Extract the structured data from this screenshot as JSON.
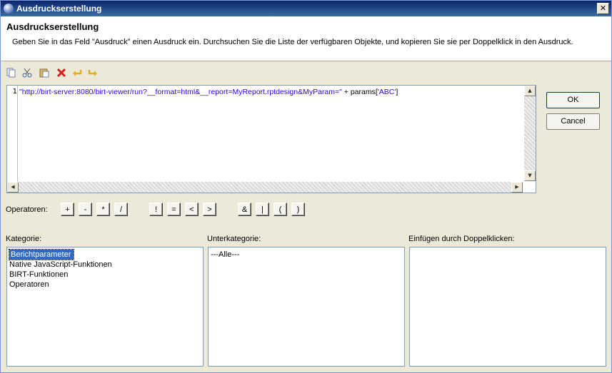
{
  "window": {
    "title": "Ausdruckserstellung"
  },
  "header": {
    "title": "Ausdruckserstellung",
    "description": "Geben Sie in das Feld \"Ausdruck\" einen Ausdruck ein. Durchsuchen Sie die Liste der verfügbaren Objekte, und kopieren Sie sie per Doppelklick in den Ausdruck."
  },
  "toolbar": {
    "icons": [
      "copy-icon",
      "cut-icon",
      "paste-icon",
      "delete-icon",
      "undo-icon",
      "redo-icon"
    ]
  },
  "editor": {
    "line_number": "1",
    "string_part": "\"http://birt-server:8080/birt-viewer/run?__format=html&__report=MyReport.rptdesign&MyParam=\"",
    "plain_part": " + params[",
    "string_part2": "'ABC'",
    "plain_end": "]"
  },
  "buttons": {
    "ok": "OK",
    "cancel": "Cancel"
  },
  "operators": {
    "label": "Operatoren:",
    "items": [
      "+",
      "-",
      "*",
      "/",
      "!",
      "=",
      "<",
      ">",
      "&",
      "|",
      "(",
      ")"
    ]
  },
  "panels": {
    "category": {
      "label": "Kategorie:",
      "items": [
        "Berichtparameter",
        "Native JavaScript-Funktionen",
        "BIRT-Funktionen",
        "Operatoren"
      ],
      "selected": "Berichtparameter"
    },
    "subcategory": {
      "label": "Unterkategorie:",
      "items": [
        "---Alle---"
      ]
    },
    "insert": {
      "label": "Einfügen durch Doppelklicken:",
      "items": []
    }
  },
  "colors": {
    "string": "#2a00ff",
    "selection": "#316ac5",
    "titlebar": "#0a246a"
  }
}
